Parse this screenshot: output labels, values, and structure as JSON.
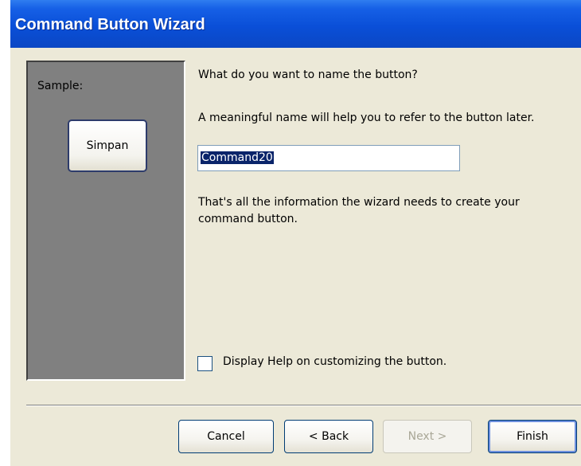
{
  "window": {
    "title": "Command Button Wizard"
  },
  "sample": {
    "label": "Sample:",
    "button_label": "Simpan"
  },
  "content": {
    "question": "What do you want to name the button?",
    "hint": "A meaningful name will help you to refer to the button later.",
    "name_value": "Command20",
    "info": "That's all the information the wizard needs to create your command button."
  },
  "options": {
    "help_checkbox_label": "Display Help on customizing the button.",
    "help_checked": false
  },
  "buttons": {
    "cancel": "Cancel",
    "back": "< Back",
    "next": "Next >",
    "finish": "Finish"
  },
  "colors": {
    "titlebar": "#0a4fd8",
    "dialog_bg": "#ece9d8",
    "sample_bg": "#808080",
    "selection": "#0a246a"
  }
}
